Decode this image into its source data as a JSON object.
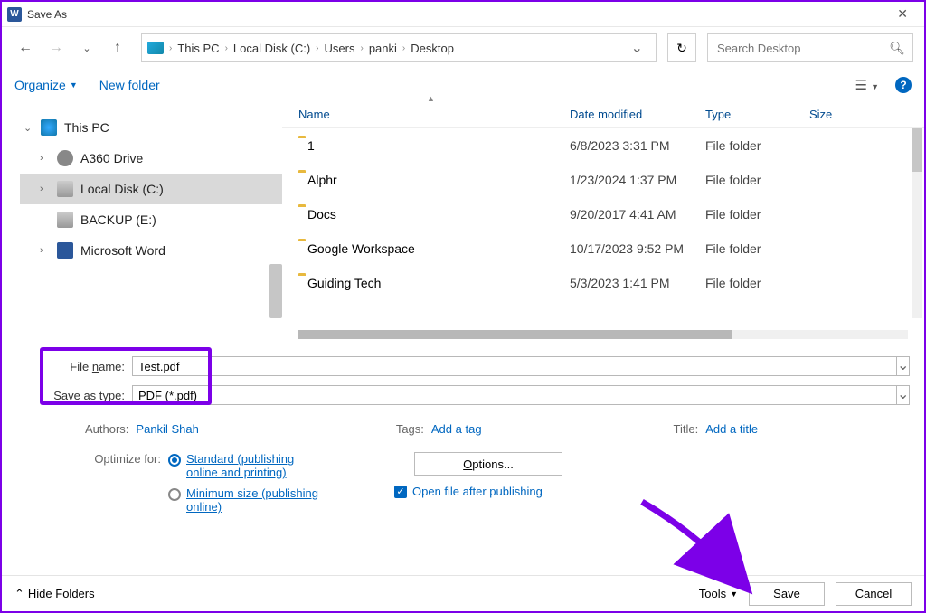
{
  "window": {
    "title": "Save As"
  },
  "nav": {
    "crumbs": [
      "This PC",
      "Local Disk (C:)",
      "Users",
      "panki",
      "Desktop"
    ],
    "search_placeholder": "Search Desktop"
  },
  "toolbar": {
    "organize": "Organize",
    "new_folder": "New folder"
  },
  "tree": {
    "root": "This PC",
    "items": [
      {
        "label": "A360 Drive",
        "icon": "cloud"
      },
      {
        "label": "Local Disk (C:)",
        "icon": "disk",
        "selected": true
      },
      {
        "label": "BACKUP (E:)",
        "icon": "disk"
      },
      {
        "label": "Microsoft Word",
        "icon": "word"
      }
    ]
  },
  "columns": {
    "name": "Name",
    "date": "Date modified",
    "type": "Type",
    "size": "Size"
  },
  "files": [
    {
      "name": "1",
      "date": "6/8/2023 3:31 PM",
      "type": "File folder"
    },
    {
      "name": "Alphr",
      "date": "1/23/2024 1:37 PM",
      "type": "File folder"
    },
    {
      "name": "Docs",
      "date": "9/20/2017 4:41 AM",
      "type": "File folder"
    },
    {
      "name": "Google Workspace",
      "date": "10/17/2023 9:52 PM",
      "type": "File folder"
    },
    {
      "name": "Guiding Tech",
      "date": "5/3/2023 1:41 PM",
      "type": "File folder"
    }
  ],
  "form": {
    "filename_label": "File name:",
    "filename_value": "Test.pdf",
    "savetype_label": "Save as type:",
    "savetype_value": "PDF (*.pdf)"
  },
  "meta": {
    "authors_label": "Authors:",
    "authors_value": "Pankil Shah",
    "tags_label": "Tags:",
    "tags_value": "Add a tag",
    "title_label": "Title:",
    "title_value": "Add a title"
  },
  "optimize": {
    "label": "Optimize for:",
    "standard": "Standard (publishing online and printing)",
    "minimum": "Minimum size (publishing online)",
    "options_btn": "Options...",
    "open_after": "Open file after publishing"
  },
  "footer": {
    "hide_folders": "Hide Folders",
    "tools": "Tools",
    "save": "Save",
    "cancel": "Cancel"
  }
}
